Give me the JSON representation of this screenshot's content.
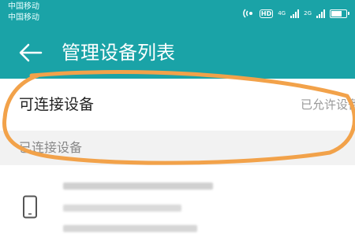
{
  "status_bar": {
    "carrier_1": "中国移动",
    "carrier_2": "中国移动",
    "hd_label": "HD",
    "net_label_1": "4G",
    "net_label_2": "2G",
    "battery_level": 0.75,
    "icons": [
      "nfc-icon",
      "hd-icon",
      "signal-icon",
      "signal-icon",
      "battery-icon"
    ]
  },
  "title_bar": {
    "back_icon": "arrow-left-icon",
    "title": "管理设备列表"
  },
  "connectable_row": {
    "label": "可连接设备",
    "value": "已允许设备"
  },
  "connected_section": {
    "header": "已连接设备",
    "device_icon": "phone-icon"
  },
  "colors": {
    "accent": "#1aa3a7",
    "highlight": "#f2a24a",
    "background": "#f2f2f2"
  }
}
